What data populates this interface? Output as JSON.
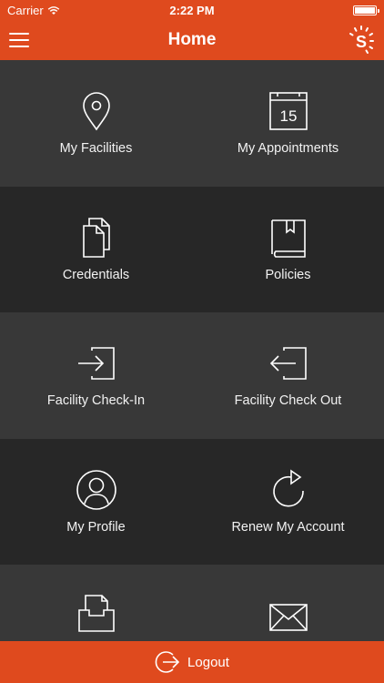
{
  "status": {
    "carrier": "Carrier",
    "time": "2:22 PM"
  },
  "header": {
    "title": "Home",
    "logo_letter": "S"
  },
  "tiles": [
    {
      "label": "My Facilities",
      "icon": "location-pin-icon"
    },
    {
      "label": "My Appointments",
      "icon": "calendar-icon",
      "calendar_day": "15"
    },
    {
      "label": "Credentials",
      "icon": "documents-icon"
    },
    {
      "label": "Policies",
      "icon": "book-icon"
    },
    {
      "label": "Facility Check-In",
      "icon": "check-in-icon"
    },
    {
      "label": "Facility Check Out",
      "icon": "check-out-icon"
    },
    {
      "label": "My Profile",
      "icon": "profile-icon"
    },
    {
      "label": "Renew My Account",
      "icon": "renew-icon"
    },
    {
      "label": "",
      "icon": "inbox-icon"
    },
    {
      "label": "",
      "icon": "mail-icon"
    }
  ],
  "footer": {
    "logout_label": "Logout"
  },
  "colors": {
    "brand": "#df4a1e",
    "tile_light": "#383838",
    "tile_dark": "#272727"
  }
}
